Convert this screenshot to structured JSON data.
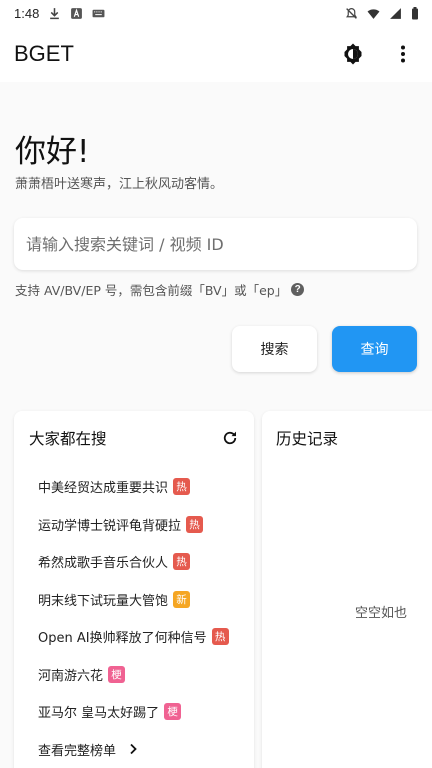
{
  "status_bar": {
    "time": "1:48",
    "left_icons": [
      "download-icon",
      "notification-a-icon",
      "notification-keyboard-icon"
    ],
    "right_icons": [
      "mute-icon",
      "wifi-icon",
      "signal-icon",
      "battery-icon"
    ]
  },
  "app_bar": {
    "title": "BGET",
    "actions": [
      "theme-toggle-icon",
      "more-vert-icon"
    ]
  },
  "greeting": {
    "title": "你好!",
    "subtitle": "萧萧梧叶送寒声，江上秋风动客情。"
  },
  "search": {
    "placeholder": "请输入搜索关键词 / 视频 ID",
    "value": "",
    "hint": "支持 AV/BV/EP 号，需包含前缀「BV」或「ep」"
  },
  "buttons": {
    "search_label": "搜索",
    "query_label": "查询"
  },
  "colors": {
    "accent": "#2196f3",
    "badge_hot": "#e55a4e",
    "badge_new": "#f5a623",
    "badge_meme": "#f06292"
  },
  "hot_card": {
    "title": "大家都在搜",
    "items": [
      {
        "text": "中美经贸达成重要共识",
        "badge": "热",
        "badge_type": "hot"
      },
      {
        "text": "运动学博士锐评龟背硬拉",
        "badge": "热",
        "badge_type": "hot"
      },
      {
        "text": "希然成歌手音乐合伙人",
        "badge": "热",
        "badge_type": "hot"
      },
      {
        "text": "明末线下试玩量大管饱",
        "badge": "新",
        "badge_type": "new"
      },
      {
        "text": "Open AI换帅释放了何种信号",
        "badge": "热",
        "badge_type": "hot"
      },
      {
        "text": "河南游六花",
        "badge": "梗",
        "badge_type": "meme"
      },
      {
        "text": "亚马尔 皇马太好踢了",
        "badge": "梗",
        "badge_type": "meme"
      }
    ],
    "more_label": "查看完整榜单"
  },
  "history_card": {
    "title": "历史记录",
    "empty_text": "空空如也"
  }
}
